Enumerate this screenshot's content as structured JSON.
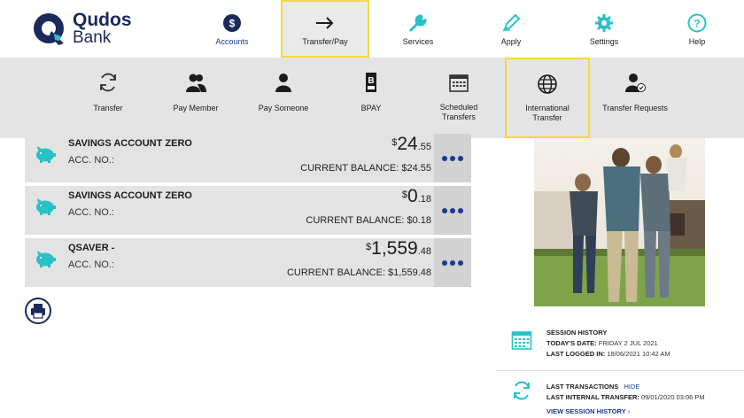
{
  "brand": {
    "line1": "Qudos",
    "line2": "Bank"
  },
  "nav": [
    {
      "label": "Accounts",
      "icon": "dollar-circle-icon"
    },
    {
      "label": "Transfer/Pay",
      "icon": "arrow-right-icon"
    },
    {
      "label": "Services",
      "icon": "wrench-icon"
    },
    {
      "label": "Apply",
      "icon": "pen-icon"
    },
    {
      "label": "Settings",
      "icon": "gear-icon"
    },
    {
      "label": "Help",
      "icon": "question-circle-icon"
    }
  ],
  "submenu": [
    {
      "label": "Transfer",
      "icon": "refresh-icon"
    },
    {
      "label": "Pay Member",
      "icon": "two-people-icon"
    },
    {
      "label": "Pay Someone",
      "icon": "person-icon"
    },
    {
      "label": "BPAY",
      "icon": "bpay-icon"
    },
    {
      "label": "Scheduled\nTransfers",
      "icon": "calendar-icon"
    },
    {
      "label": "International\nTransfer",
      "icon": "globe-icon"
    },
    {
      "label": "Transfer Requests",
      "icon": "person-check-icon"
    }
  ],
  "accounts": [
    {
      "name": "SAVINGS ACCOUNT ZERO",
      "acc_label": "ACC. NO.:",
      "currency": "$",
      "major": "24",
      "minor": ".55",
      "balance": "CURRENT BALANCE: $24.55"
    },
    {
      "name": "SAVINGS ACCOUNT ZERO",
      "acc_label": "ACC. NO.:",
      "currency": "$",
      "major": "0",
      "minor": ".18",
      "balance": "CURRENT BALANCE: $0.18"
    },
    {
      "name": "QSAVER -",
      "acc_label": "ACC. NO.:",
      "currency": "$",
      "major": "1,559",
      "minor": ".48",
      "balance": "CURRENT BALANCE: $1,559.48"
    }
  ],
  "session": {
    "heading": "SESSION HISTORY",
    "date_label": "TODAY'S DATE:",
    "date_value": "FRIDAY 2 JUL 2021",
    "login_label": "LAST LOGGED IN:",
    "login_value": "18/06/2021 10:42 AM"
  },
  "transactions": {
    "heading": "LAST TRANSACTIONS",
    "hide": "HIDE",
    "internal_label": "LAST INTERNAL TRANSFER:",
    "internal_value": "09/01/2020 03:06 PM",
    "view_history": "VIEW SESSION HISTORY"
  },
  "colors": {
    "navy": "#1b2a5c",
    "teal": "#29c1c6",
    "accent_blue": "#1a3a8c",
    "highlight": "#f5d93a"
  }
}
